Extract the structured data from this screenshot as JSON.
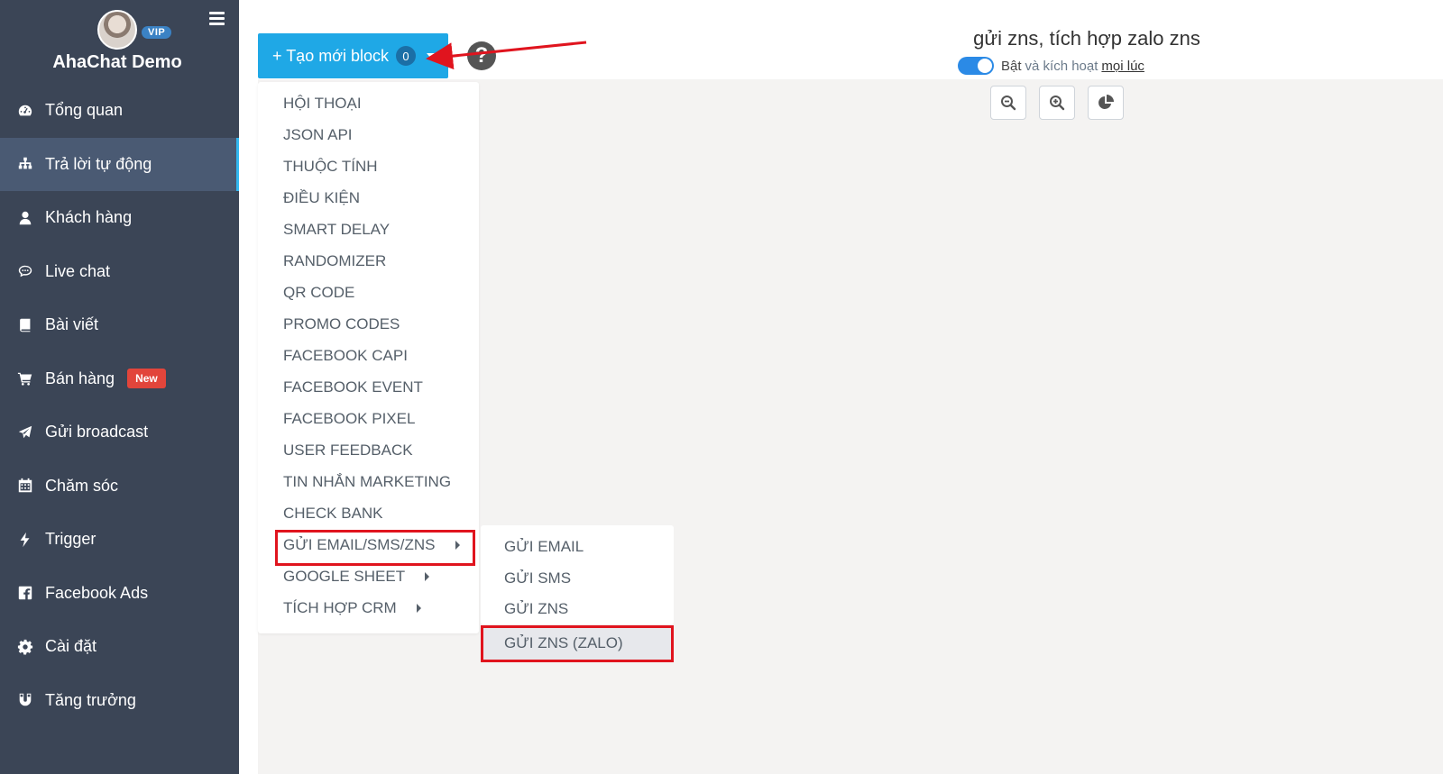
{
  "brand": {
    "name": "AhaChat Demo",
    "vip_label": "VIP"
  },
  "sidebar": {
    "items": [
      {
        "label": "Tổng quan",
        "icon": "dashboard-icon"
      },
      {
        "label": "Trả lời tự động",
        "icon": "sitemap-icon",
        "active": true
      },
      {
        "label": "Khách hàng",
        "icon": "user-icon"
      },
      {
        "label": "Live chat",
        "icon": "chat-bubble-icon"
      },
      {
        "label": "Bài viết",
        "icon": "book-icon"
      },
      {
        "label": "Bán hàng",
        "icon": "cart-icon",
        "badge": "New"
      },
      {
        "label": "Gửi broadcast",
        "icon": "paper-plane-icon"
      },
      {
        "label": "Chăm sóc",
        "icon": "calendar-icon"
      },
      {
        "label": "Trigger",
        "icon": "bolt-icon"
      },
      {
        "label": "Facebook Ads",
        "icon": "facebook-icon"
      },
      {
        "label": "Cài đặt",
        "icon": "gear-icon"
      },
      {
        "label": "Tăng trưởng",
        "icon": "magnet-icon"
      }
    ]
  },
  "toolbar": {
    "create_label": "+ Tạo mới block",
    "create_count": "0",
    "help_icon": "question-circle-icon"
  },
  "header": {
    "title": "gửi zns, tích hợp zalo zns",
    "toggle_on": "Bật",
    "toggle_text": "và kích hoạt",
    "toggle_link": "mọi lúc"
  },
  "canvas_tools": [
    "zoom-out-icon",
    "zoom-in-icon",
    "pie-chart-icon"
  ],
  "dropdown": {
    "items": [
      {
        "label": "HỘI THOẠI"
      },
      {
        "label": "JSON API"
      },
      {
        "label": "THUỘC TÍNH"
      },
      {
        "label": "ĐIỀU KIỆN"
      },
      {
        "label": "SMART DELAY"
      },
      {
        "label": "RANDOMIZER"
      },
      {
        "label": "QR CODE"
      },
      {
        "label": "PROMO CODES"
      },
      {
        "label": "FACEBOOK CAPI"
      },
      {
        "label": "FACEBOOK EVENT"
      },
      {
        "label": "FACEBOOK PIXEL"
      },
      {
        "label": "USER FEEDBACK"
      },
      {
        "label": "TIN NHẮN MARKETING"
      },
      {
        "label": "CHECK BANK"
      },
      {
        "label": "GỬI EMAIL/SMS/ZNS",
        "submenu": true,
        "highlighted": true
      },
      {
        "label": "GOOGLE SHEET",
        "submenu": true
      },
      {
        "label": "TÍCH HỢP CRM",
        "submenu": true
      }
    ]
  },
  "submenu": {
    "items": [
      {
        "label": "GỬI EMAIL"
      },
      {
        "label": "GỬI SMS"
      },
      {
        "label": "GỬI ZNS"
      },
      {
        "label": "GỬI ZNS (ZALO)",
        "highlighted": true
      }
    ]
  },
  "colors": {
    "sidebar_bg": "#3b4556",
    "sidebar_active": "#4a5a73",
    "accent": "#1fa8e6",
    "annotation_red": "#e0141e",
    "badge_new": "#e2453b"
  }
}
